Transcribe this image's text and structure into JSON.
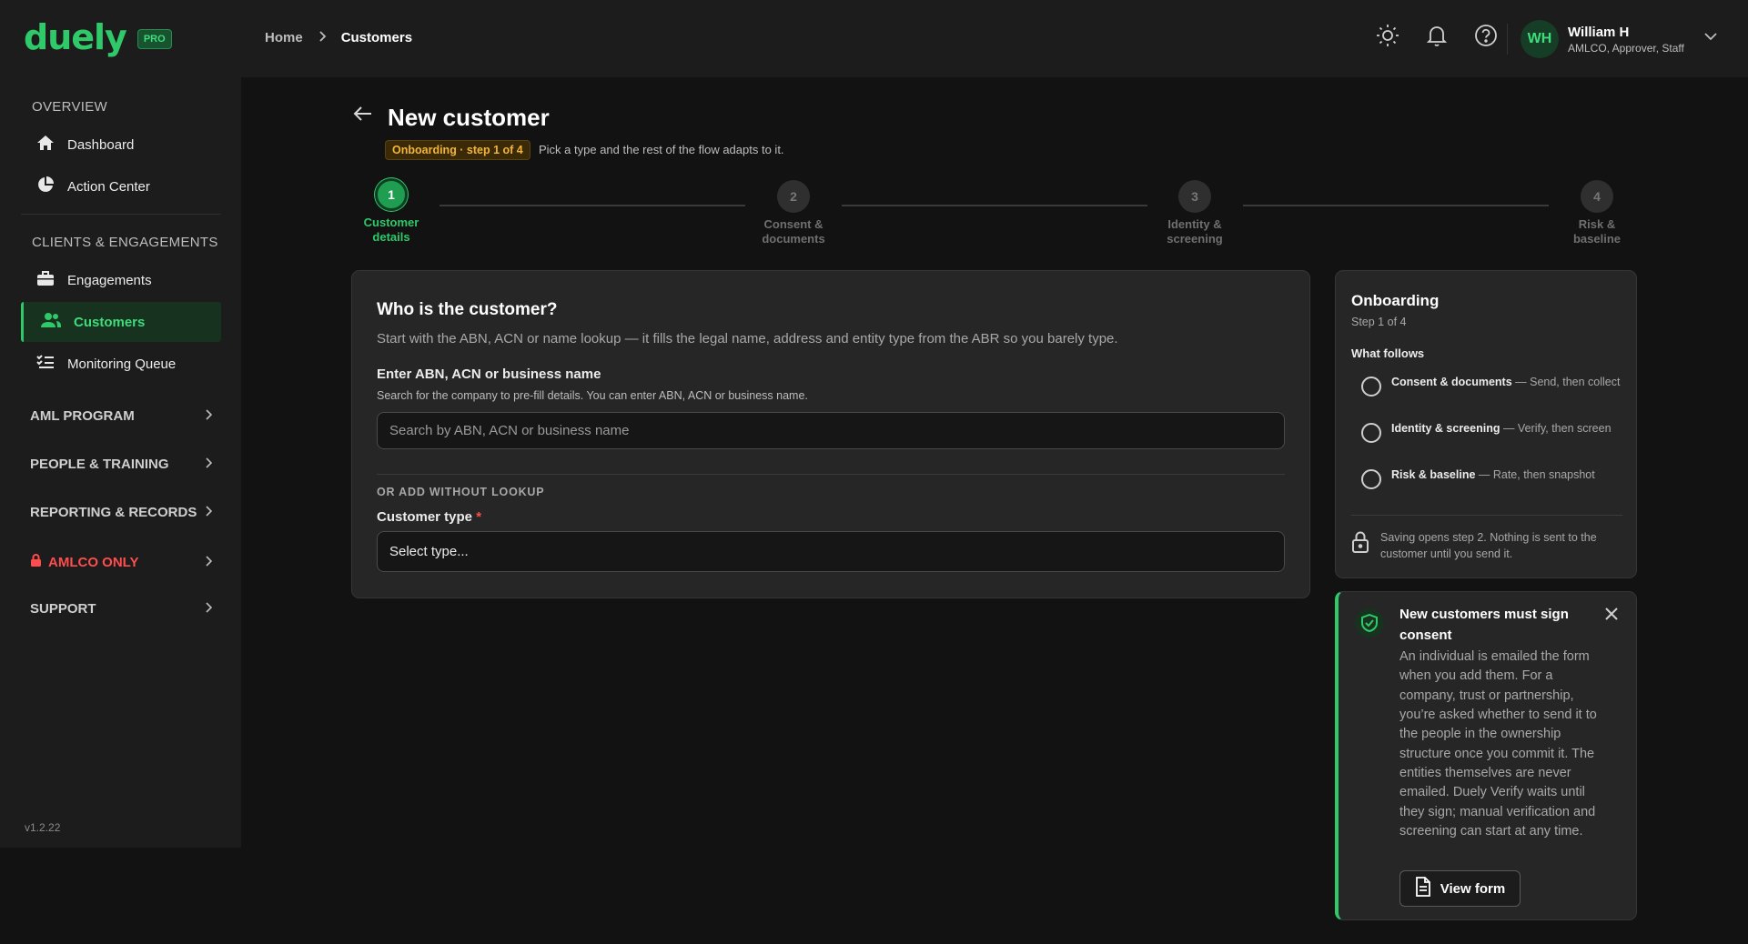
{
  "app": {
    "logo": "duely",
    "badge": "PRO",
    "version": "v1.2.22"
  },
  "breadcrumb": {
    "home": "Home",
    "current": "Customers"
  },
  "user": {
    "initials": "WH",
    "name": "William H",
    "role": "AMLCO, Approver, Staff"
  },
  "sidebar": {
    "overview_title": "OVERVIEW",
    "overview_items": [
      {
        "label": "Dashboard",
        "icon": "home-icon"
      },
      {
        "label": "Action Center",
        "icon": "pie-chart-icon"
      }
    ],
    "clients_title": "CLIENTS & ENGAGEMENTS",
    "clients_items": [
      {
        "label": "Engagements",
        "icon": "briefcase-icon"
      },
      {
        "label": "Customers",
        "icon": "users-icon",
        "active": true
      },
      {
        "label": "Monitoring Queue",
        "icon": "list-check-icon"
      }
    ],
    "groups": [
      {
        "label": "AML PROGRAM"
      },
      {
        "label": "PEOPLE & TRAINING"
      },
      {
        "label": "REPORTING & RECORDS"
      },
      {
        "label": "AMLCO ONLY",
        "icon": "lock-icon",
        "color": "#ff4d4d"
      },
      {
        "label": "SUPPORT"
      }
    ]
  },
  "page": {
    "title": "New customer",
    "badge": "Onboarding · step 1 of 4",
    "subtitle": "Pick a type and the rest of the flow adapts to it."
  },
  "steps": [
    {
      "number": "1",
      "line1": "Customer",
      "line2": "details",
      "active": true
    },
    {
      "number": "2",
      "line1": "Consent &",
      "line2": "documents"
    },
    {
      "number": "3",
      "line1": "Identity &",
      "line2": "screening"
    },
    {
      "number": "4",
      "line1": "Risk &",
      "line2": "baseline"
    }
  ],
  "form": {
    "title": "Who is the customer?",
    "description": "Start with the ABN, ACN or name lookup — it fills the legal name, address and entity type from the ABR so you barely type.",
    "lookup_label": "Enter ABN, ACN or business name",
    "lookup_help": "Search for the company to pre-fill details. You can enter ABN, ACN or business name.",
    "lookup_placeholder": "Search by ABN, ACN or business name",
    "or_label": "OR ADD WITHOUT LOOKUP",
    "type_label": "Customer type",
    "required_mark": "*",
    "type_value": "Select type..."
  },
  "onboarding_panel": {
    "title": "Onboarding",
    "step": "Step 1 of 4",
    "follows_title": "What follows",
    "items": [
      {
        "bold": "Consent & documents",
        "rest": " — Send, then collect"
      },
      {
        "bold": "Identity & screening",
        "rest": " — Verify, then screen"
      },
      {
        "bold": "Risk & baseline",
        "rest": " — Rate, then snapshot"
      }
    ],
    "note": "Saving opens step 2. Nothing is sent to the customer until you send it."
  },
  "alert": {
    "title": "New customers must sign consent",
    "body": "An individual is emailed the form when you add them. For a company, trust or partnership, you’re asked whether to send it to the people in the ownership structure once you commit it. The entities themselves are never emailed. Duely Verify waits until they sign; manual verification and screening can start at any time.",
    "button": "View form"
  },
  "colors": {
    "accent": "#2fc96a",
    "danger": "#ff4d4d",
    "warning": "#f3b43a"
  }
}
